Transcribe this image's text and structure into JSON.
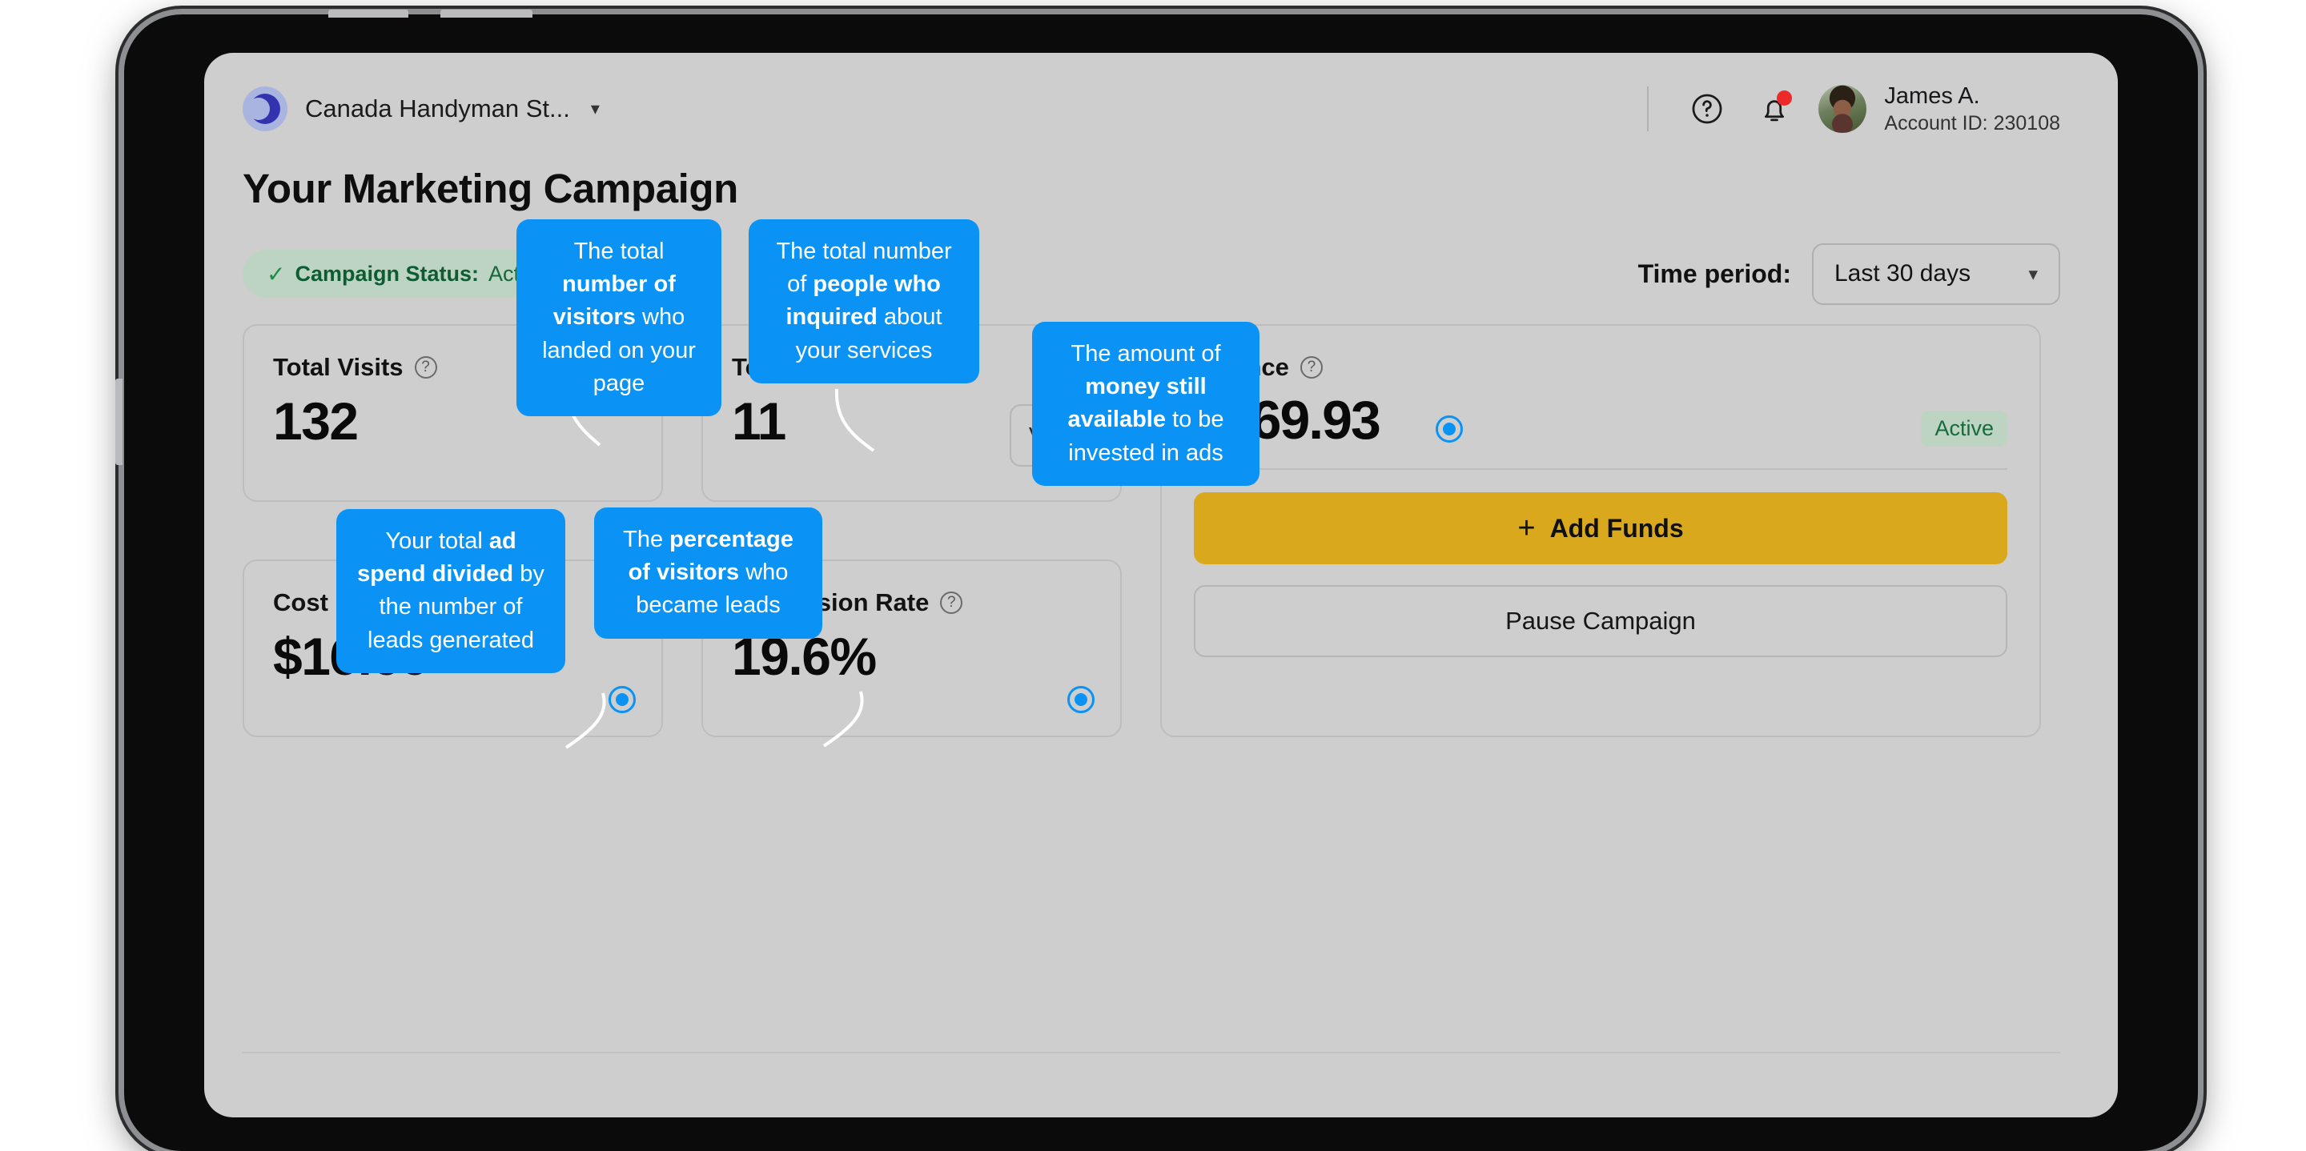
{
  "brand": {
    "name": "Canada Handyman St...",
    "logo_icon": "circle-c-logo",
    "chevron_icon": "chevron-down-icon"
  },
  "account": {
    "help_icon": "question-circle-icon",
    "notifications_icon": "bell-icon",
    "avatar_icon": "user-avatar",
    "name": "James A.",
    "account_id": "Account ID: 230108"
  },
  "page": {
    "title": "Your Marketing Campaign",
    "status_check_icon": "check-icon",
    "status_label": "Campaign Status:",
    "status_value": "Active"
  },
  "time_period": {
    "label": "Time period:",
    "value": "Last 30 days",
    "chevron_icon": "chevron-down-icon"
  },
  "metrics": [
    {
      "label": "Total Visits",
      "value": "132",
      "help_icon": "question-circle-icon"
    },
    {
      "label": "Total Leads",
      "value": "11",
      "help_icon": "question-circle-icon",
      "action": "View"
    },
    {
      "label": "Cost per Lead",
      "value": "$16.66",
      "help_icon": "question-circle-icon"
    },
    {
      "label": "Conversion Rate",
      "value": "19.6%",
      "help_icon": "question-circle-icon"
    }
  ],
  "balance": {
    "label": "Balance",
    "help_icon": "question-circle-icon",
    "value": "$169.93",
    "badge": "Active",
    "add_funds_plus": "+",
    "add_funds_label": "Add Funds",
    "pause_label": "Pause Campaign"
  },
  "tooltips": {
    "total_visits": {
      "pre": "The total ",
      "bold": "number of visitors",
      "post": " who landed on your page"
    },
    "total_leads": {
      "pre": "The total number of ",
      "bold": "people who inquired",
      "post": " about your services"
    },
    "balance": {
      "pre": "The amount of ",
      "bold": "money still available",
      "post": " to be invested in ads"
    },
    "cost_per_lead": {
      "pre": "Your total ",
      "bold": "ad spend divided",
      "post": " by the number of leads generated"
    },
    "conversion_rate": {
      "pre": "The ",
      "bold": "percentage of visitors",
      "post": " who became leads"
    }
  },
  "colors": {
    "accent_blue": "#0a93f5",
    "funds_gold": "#d9a81c",
    "status_green_bg": "#bcd4c1",
    "status_green_text": "#16663c",
    "screen_bg": "#cecece"
  }
}
